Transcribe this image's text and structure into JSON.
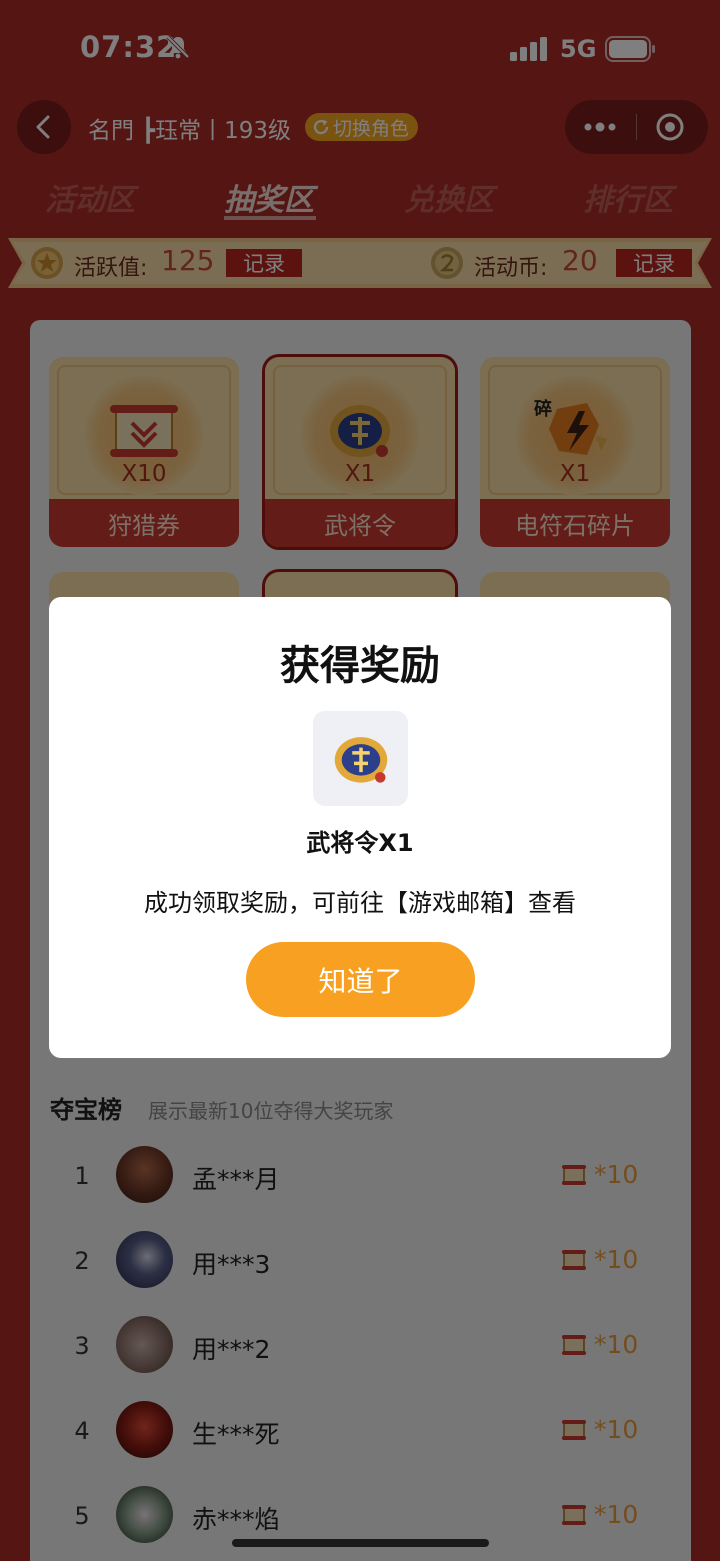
{
  "status_bar": {
    "time": "07:32",
    "network": "5G"
  },
  "nav": {
    "title": "名門 ┣珏常丨193级",
    "switch_role_label": "切换角色"
  },
  "tabs": [
    {
      "label": "活动区"
    },
    {
      "label": "抽奖区"
    },
    {
      "label": "兑换区"
    },
    {
      "label": "排行区"
    }
  ],
  "active_tab": "抽奖区",
  "ribbon": {
    "activity_label": "活跃值:",
    "activity_value": "125",
    "activity_record": "记录",
    "coin_label": "活动币:",
    "coin_value": "20",
    "coin_record": "记录"
  },
  "prizes": [
    {
      "name": "狩猎券",
      "qty": "X10",
      "icon": "scroll-icon"
    },
    {
      "name": "武将令",
      "qty": "X1",
      "icon": "general-token-icon",
      "selected": true
    },
    {
      "name": "电符石碎片",
      "qty": "X1",
      "icon": "thunder-stone-fragment-icon",
      "badge": "碎"
    }
  ],
  "modal": {
    "title": "获得奖励",
    "item_name": "武将令X1",
    "description": "成功领取奖励，可前往【游戏邮箱】查看",
    "button_label": "知道了"
  },
  "leaderboard": {
    "title": "夺宝榜",
    "subtitle": "展示最新10位夺得大奖玩家",
    "rows": [
      {
        "rank": "1",
        "name": "孟***月",
        "reward": "*10"
      },
      {
        "rank": "2",
        "name": "用***3",
        "reward": "*10"
      },
      {
        "rank": "3",
        "name": "用***2",
        "reward": "*10"
      },
      {
        "rank": "4",
        "name": "生***死",
        "reward": "*10"
      },
      {
        "rank": "5",
        "name": "赤***焰",
        "reward": "*10"
      }
    ]
  },
  "colors": {
    "background": "#a82a27",
    "accent_orange": "#f7a021",
    "record_button": "#b8271f",
    "prize_label": "#c7392e"
  }
}
